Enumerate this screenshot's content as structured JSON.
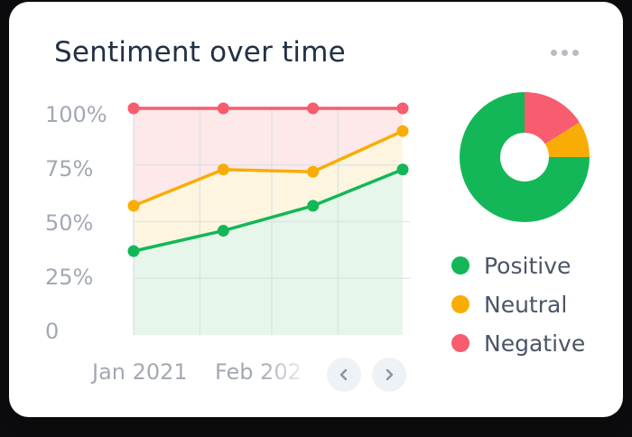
{
  "card": {
    "title": "Sentiment over time"
  },
  "icons": {
    "more": "more-horizontal-icon",
    "prev": "chevron-left-icon",
    "next": "chevron-right-icon"
  },
  "colors": {
    "positive": "#13b757",
    "neutral": "#f8ad06",
    "negative": "#f75c6f"
  },
  "chart_data": [
    {
      "type": "area",
      "title": "Sentiment over time",
      "xlabel": "",
      "ylabel": "",
      "ylim": [
        0,
        100
      ],
      "y_ticks": [
        "100%",
        "75%",
        "50%",
        "25%",
        "0"
      ],
      "x_tick_labels": [
        "Jan 2021",
        "Feb 2021"
      ],
      "x_visible_labels": [
        "Jan 2021",
        "Feb 202"
      ],
      "grid": true,
      "stacked_cumulative": true,
      "series": [
        {
          "name": "Positive",
          "color": "#13b757",
          "values": [
            37,
            46,
            57,
            73
          ]
        },
        {
          "name": "Neutral",
          "color": "#f8ad06",
          "values": [
            57,
            73,
            72,
            90
          ]
        },
        {
          "name": "Negative",
          "color": "#f75c6f",
          "values": [
            100,
            100,
            100,
            100
          ]
        }
      ]
    },
    {
      "type": "pie",
      "donut": true,
      "slices": [
        {
          "name": "Positive",
          "value": 75,
          "color": "#13b757"
        },
        {
          "name": "Neutral",
          "value": 9,
          "color": "#f8ad06"
        },
        {
          "name": "Negative",
          "value": 16,
          "color": "#f75c6f"
        }
      ],
      "legend": [
        "Positive",
        "Neutral",
        "Negative"
      ],
      "legend_position": "bottom"
    }
  ]
}
